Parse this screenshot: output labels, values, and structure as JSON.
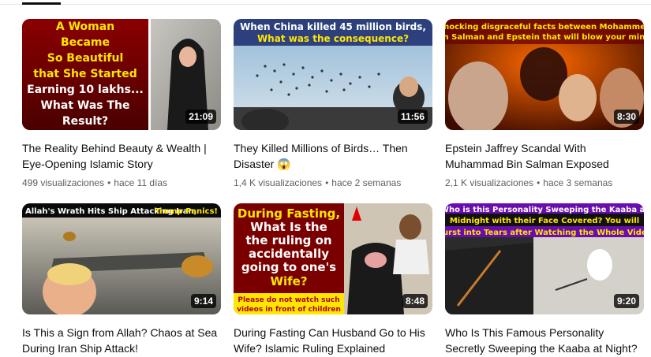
{
  "videos": [
    {
      "title": "The Reality Behind Beauty & Wealth | Eye-Opening Islamic Story",
      "views": "499 visualizaciones",
      "age": "hace 11 días",
      "duration": "21:09",
      "thumb_text": [
        "A Woman",
        "Became",
        "So Beautiful",
        "that She Started",
        "Earning 10 lakhs...",
        "What Was The",
        "Result?"
      ]
    },
    {
      "title": "They Killed Millions of Birds… Then Disaster 😱",
      "views": "1,4 K visualizaciones",
      "age": "hace 2 semanas",
      "duration": "11:56",
      "thumb_text": [
        "When China killed 45 million birds,",
        "What was the consequence?"
      ]
    },
    {
      "title": "Epstein Jaffrey Scandal With Muhammad Bin Salman Exposed",
      "views": "2,1 K visualizaciones",
      "age": "hace 3 semanas",
      "duration": "8:30",
      "thumb_text": [
        "Shocking disgraceful facts between Mohammed",
        "bin Salman and Epstein that will blow your mind!"
      ]
    },
    {
      "title": "Is This a Sign from Allah? Chaos at Sea During Iran Ship Attack!",
      "views": "",
      "age": "",
      "duration": "9:14",
      "thumb_text": [
        "Allah's Wrath Hits Ship Attacking Iran,",
        "Trump Panics!"
      ]
    },
    {
      "title": "During Fasting Can Husband Go to His Wife? Islamic Ruling Explained",
      "views": "",
      "age": "",
      "duration": "8:48",
      "thumb_text": [
        "During Fasting,",
        "What Is the",
        "the ruling on",
        "accidentally",
        "going to one's",
        "Wife?",
        "Please do not watch such",
        "videos in front of children"
      ]
    },
    {
      "title": "Who Is This Famous Personality Secretly Sweeping the Kaaba at Night?",
      "views": "",
      "age": "",
      "duration": "9:20",
      "thumb_text": [
        "Who is this Personality Sweeping the Kaaba at",
        "Midnight with their Face Covered? You will",
        "Burst into Tears after Watching the Whole Video"
      ]
    }
  ],
  "meta_separator": "•",
  "colors": {
    "text_primary": "#0f0f0f",
    "text_secondary": "#606060",
    "thumb_yellow": "#ffe600",
    "thumb_red": "#d80000"
  }
}
